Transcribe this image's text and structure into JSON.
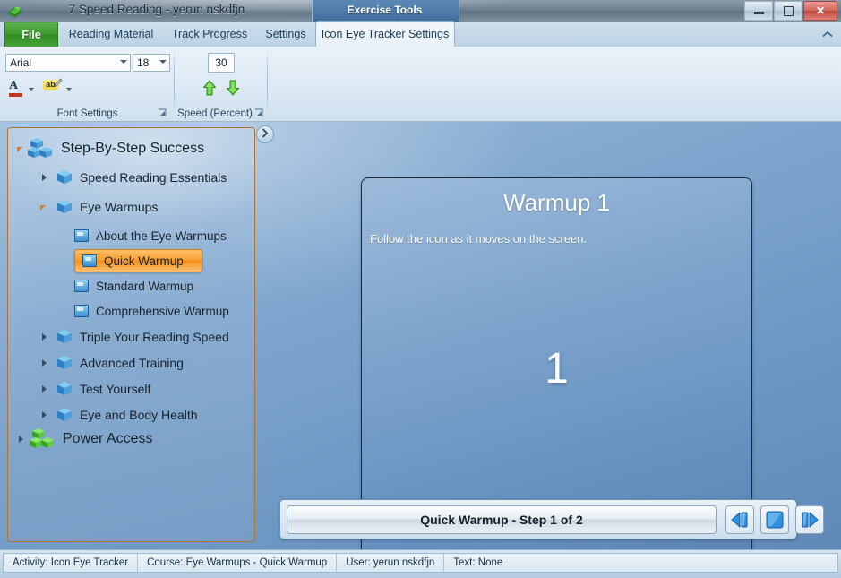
{
  "window": {
    "title": "7 Speed Reading - yerun nskdfjn",
    "app_icon": "green-book-icon",
    "contextual_group": "Exercise Tools",
    "buttons": {
      "minimize": "minimize-icon",
      "restore": "restore-icon",
      "close": "✕"
    }
  },
  "ribbon": {
    "file_tab": "File",
    "tabs": [
      {
        "label": "Reading Material",
        "active": false
      },
      {
        "label": "Track Progress",
        "active": false
      },
      {
        "label": "Settings",
        "active": false
      },
      {
        "label": "Icon Eye Tracker Settings",
        "active": true
      }
    ],
    "collapse_icon": "chevron-up-icon",
    "groups": [
      {
        "name": "Font Settings",
        "font_family": "Arial",
        "font_size": "18",
        "font_color_glyph": "A",
        "highlight_glyph": "ab",
        "dialog_launcher": "dialog-launcher-icon"
      },
      {
        "name": "Speed (Percent)",
        "speed_value": "30",
        "increase_icon": "green-up-arrow-icon",
        "decrease_icon": "green-down-arrow-icon",
        "dialog_launcher": "dialog-launcher-icon"
      }
    ]
  },
  "sidebar": {
    "expander_icon": "chevron-right-icon",
    "nodes": [
      {
        "label": "Step-By-Step Success",
        "level": 0,
        "icon": "blue-cubes-icon",
        "state": "expanded",
        "selected": false
      },
      {
        "label": "Speed Reading Essentials",
        "level": 1,
        "icon": "blue-cube-icon",
        "state": "collapsed",
        "selected": false
      },
      {
        "label": "Eye Warmups",
        "level": 1,
        "icon": "blue-cube-icon",
        "state": "expanded",
        "selected": false
      },
      {
        "label": "About the Eye Warmups",
        "level": 2,
        "icon": "page-icon",
        "state": "leaf",
        "selected": false
      },
      {
        "label": "Quick Warmup",
        "level": 2,
        "icon": "page-icon",
        "state": "leaf",
        "selected": true
      },
      {
        "label": "Standard Warmup",
        "level": 2,
        "icon": "page-icon",
        "state": "leaf",
        "selected": false
      },
      {
        "label": "Comprehensive Warmup",
        "level": 2,
        "icon": "page-icon",
        "state": "leaf",
        "selected": false
      },
      {
        "label": "Triple Your Reading Speed",
        "level": 1,
        "icon": "blue-cube-icon",
        "state": "collapsed",
        "selected": false
      },
      {
        "label": "Advanced Training",
        "level": 1,
        "icon": "blue-cube-icon",
        "state": "collapsed",
        "selected": false
      },
      {
        "label": "Test Yourself",
        "level": 1,
        "icon": "blue-cube-icon",
        "state": "collapsed",
        "selected": false
      },
      {
        "label": "Eye and Body Health",
        "level": 1,
        "icon": "blue-cube-icon",
        "state": "collapsed",
        "selected": false
      },
      {
        "label": "Power Access",
        "level": 0,
        "icon": "green-cubes-icon",
        "state": "collapsed",
        "selected": false
      }
    ]
  },
  "exercise": {
    "title": "Warmup 1",
    "instruction": "Follow the icon as it moves on the screen.",
    "token": "1"
  },
  "controls": {
    "step_label": "Quick Warmup - Step 1 of 2",
    "previous_icon": "previous-icon",
    "stop_icon": "stop-icon",
    "next_icon": "next-icon"
  },
  "status": {
    "activity": "Activity: Icon Eye Tracker",
    "course": "Course: Eye Warmups - Quick Warmup",
    "user": "User: yerun nskdfjn",
    "text": "Text: None"
  },
  "colors": {
    "accent_orange": "#f2901b",
    "file_green": "#3f9a31",
    "close_red": "#c2463c",
    "panel_blue": "#6590bf"
  }
}
